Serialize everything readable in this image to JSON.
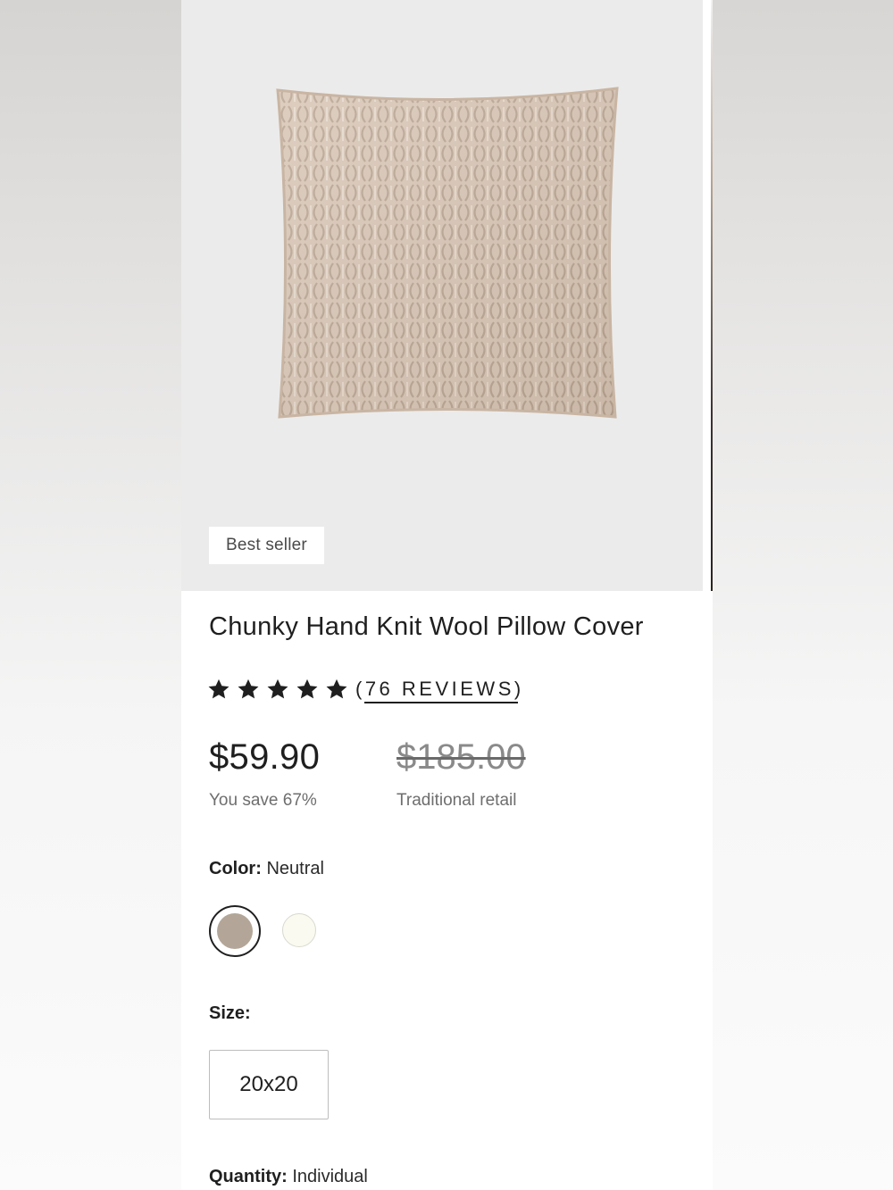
{
  "product": {
    "badge": "Best seller",
    "title": "Chunky Hand Knit Wool Pillow Cover",
    "rating": 5,
    "reviews_label": "(76 REVIEWS)",
    "price": "$59.90",
    "savings": "You save 67%",
    "original_price": "$185.00",
    "original_price_label": "Traditional retail"
  },
  "color": {
    "label": "Color:",
    "selected": "Neutral",
    "swatches": [
      {
        "name": "neutral",
        "hex": "#b3a698",
        "selected": true
      },
      {
        "name": "ivory",
        "hex": "#fbfaf0",
        "selected": false
      }
    ]
  },
  "size": {
    "label": "Size:",
    "options": [
      "20x20"
    ]
  },
  "quantity": {
    "label": "Quantity:",
    "selected": "Individual"
  },
  "colors": {
    "text": "#1f1f1f",
    "muted": "#6e6e6e",
    "hero_bg": "#ebebeb",
    "pillow": "#d8c6b6"
  }
}
